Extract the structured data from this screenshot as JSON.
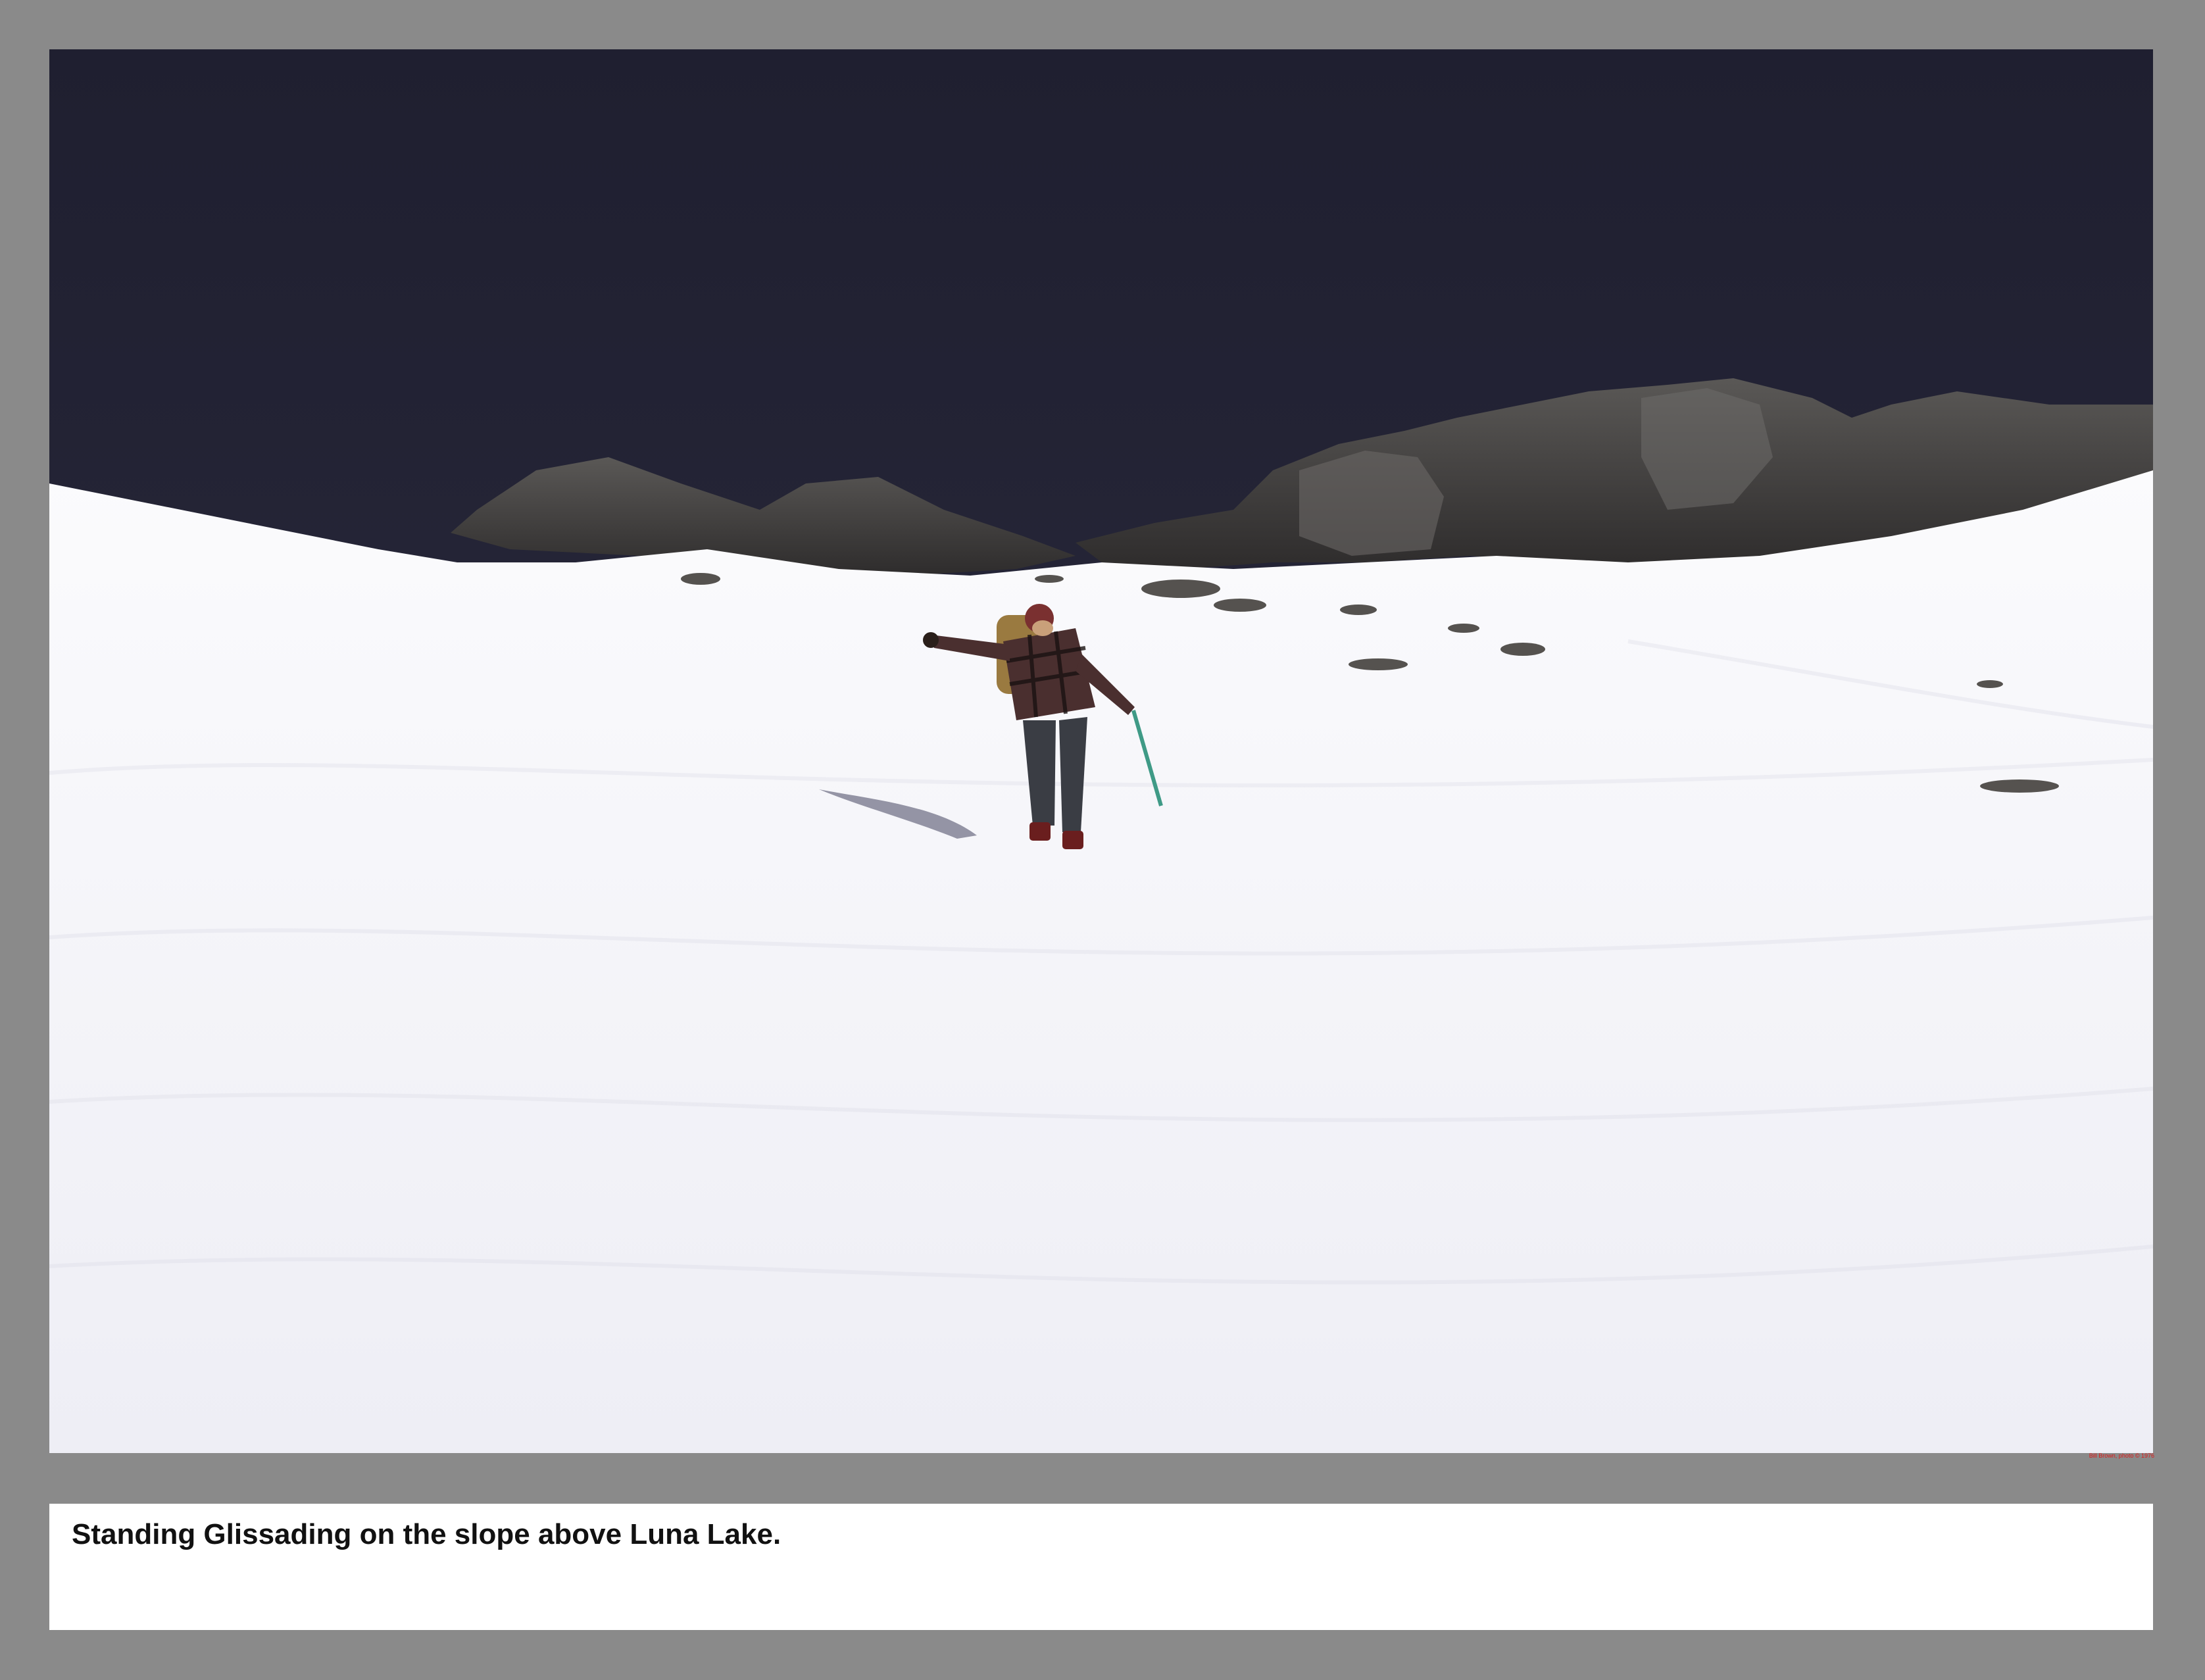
{
  "photo": {
    "subject": "Climber standing glissading down a snow slope with an ice axe below dark rocky ridge",
    "colors": {
      "sky": "#262638",
      "snow": "#f6f6fa",
      "rock": "#3c3a3a",
      "frame": "#8a8a8a"
    },
    "credit": "Bill Brown, photo © 1976"
  },
  "caption": {
    "text": "Standing Glissading on the slope above Luna Lake."
  }
}
